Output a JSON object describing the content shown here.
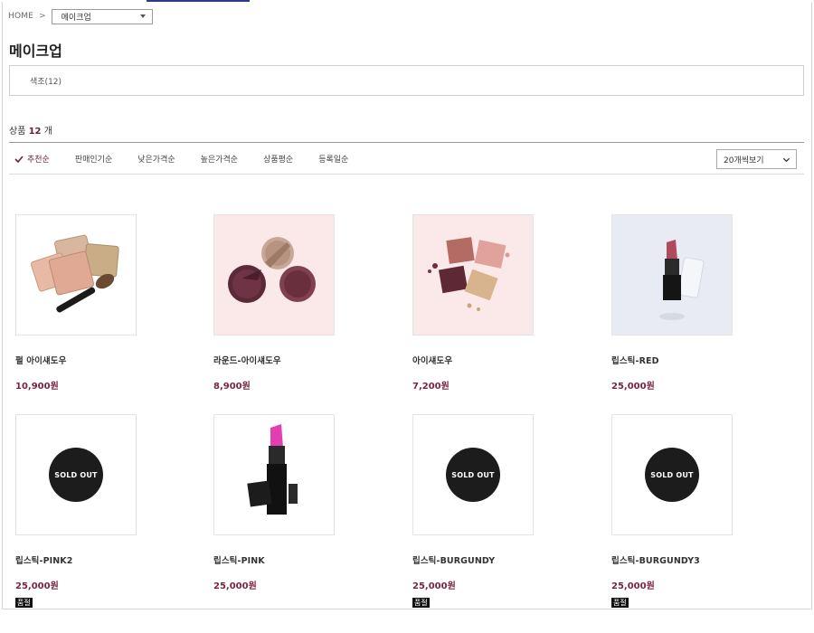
{
  "breadcrumb": {
    "home": "HOME",
    "separator": ">",
    "category_select": "메이크업"
  },
  "page_title": "메이크업",
  "subcategories": [
    {
      "label": "색조(12)"
    }
  ],
  "product_count": {
    "prefix": "상품",
    "count": "12",
    "suffix": "개"
  },
  "sort_options": [
    {
      "label": "추천순",
      "active": true
    },
    {
      "label": "판매인기순",
      "active": false
    },
    {
      "label": "낮은가격순",
      "active": false
    },
    {
      "label": "높은가격순",
      "active": false
    },
    {
      "label": "상품평순",
      "active": false
    },
    {
      "label": "등록일순",
      "active": false
    }
  ],
  "view_select": "20개씩보기",
  "sold_out_label": "SOLD OUT",
  "products": [
    {
      "name": "펄 아이섀도우",
      "price": "10,900원",
      "image": "pearl-eyeshadow-image",
      "sold_out": false,
      "badge": ""
    },
    {
      "name": "라운드-아이섀도우",
      "price": "8,900원",
      "image": "round-eyeshadow-image",
      "sold_out": false,
      "badge": ""
    },
    {
      "name": "아이섀도우",
      "price": "7,200원",
      "image": "eyeshadow-image",
      "sold_out": false,
      "badge": ""
    },
    {
      "name": "립스틱-RED",
      "price": "25,000원",
      "image": "lipstick-red-image",
      "sold_out": false,
      "badge": ""
    },
    {
      "name": "립스틱-PINK2",
      "price": "25,000원",
      "image": "sold-out-image",
      "sold_out": true,
      "badge": "품절"
    },
    {
      "name": "립스틱-PINK",
      "price": "25,000원",
      "image": "lipstick-pink-image",
      "sold_out": false,
      "badge": ""
    },
    {
      "name": "립스틱-BURGUNDY",
      "price": "25,000원",
      "image": "sold-out-image",
      "sold_out": true,
      "badge": "품절"
    },
    {
      "name": "립스틱-BURGUNDY3",
      "price": "25,000원",
      "image": "sold-out-image",
      "sold_out": true,
      "badge": "품절"
    }
  ],
  "colors": {
    "accent": "#6b1f3a",
    "price": "#7a2540",
    "sold_out_badge": "#111111"
  }
}
